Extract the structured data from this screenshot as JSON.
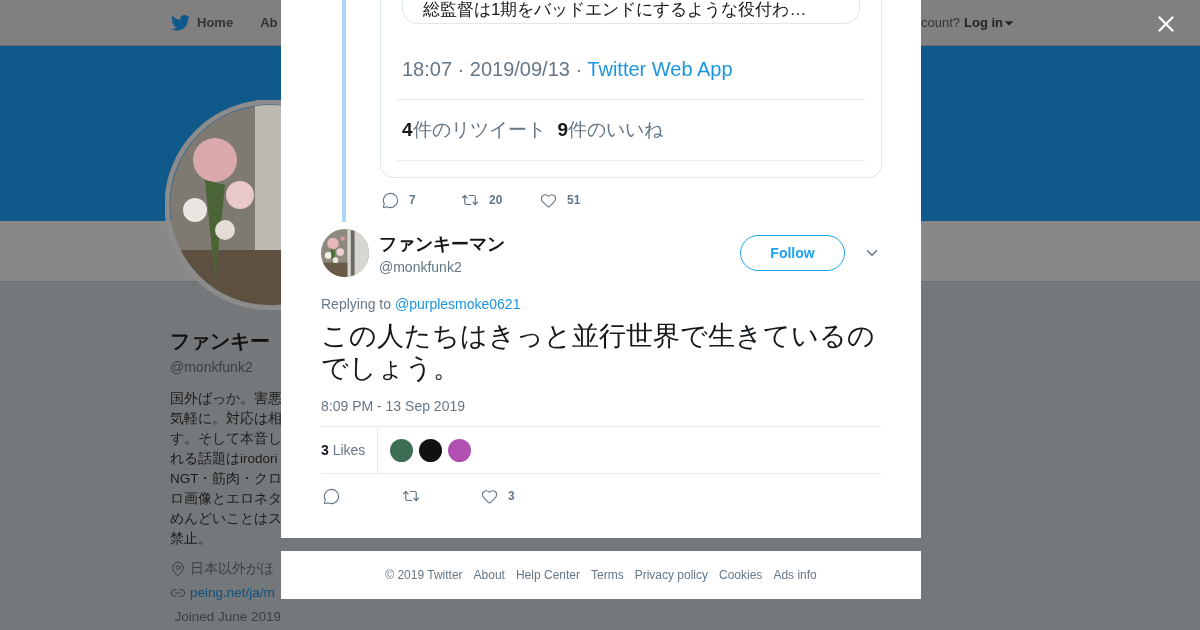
{
  "nav": {
    "items": [
      "Home",
      "Ab"
    ],
    "login_prompt": "count?",
    "login": "Log in"
  },
  "profile": {
    "name": "ファンキー",
    "handle": "@monkfunk2",
    "bio_lines": [
      "国外ばっか。害悪",
      "気軽に。対応は相",
      "す。そして本音し",
      "れる話題はirodori",
      "NGT・筋肉・クロ",
      "ロ画像とエロネタ",
      "めんどいことはス",
      "禁止。"
    ],
    "location": "日本以外がほ",
    "link": "peing.net/ja/m",
    "joined": "Joined June 2019"
  },
  "quoted": {
    "text": "総監督は1期をバッドエンドにするような役付わ…",
    "meta": "18:07 · 2019/09/13 · ",
    "source": "Twitter Web App",
    "retweet_count": "4",
    "retweet_label": "件のリツイート",
    "like_count": "9",
    "like_label": "件のいいね",
    "actions": [
      {
        "kind": "reply",
        "count": "7"
      },
      {
        "kind": "retweet",
        "count": "20"
      },
      {
        "kind": "like",
        "count": "51"
      }
    ]
  },
  "tweet": {
    "name": "ファンキーマン",
    "handle": "@monkfunk2",
    "follow": "Follow",
    "replying_label": "Replying to",
    "replying_to": "@purplesmoke0621",
    "text": "この人たちはきっと並行世界で生きているのでしょう。",
    "time": "8:09 PM - 13 Sep 2019",
    "likes_count": "3",
    "likes_label": "Likes",
    "likers": [
      {
        "color": "#3b6e52"
      },
      {
        "color": "#111111"
      },
      {
        "color": "#b24fb3"
      }
    ],
    "actions": [
      {
        "kind": "reply"
      },
      {
        "kind": "retweet"
      },
      {
        "kind": "like",
        "count": "3"
      }
    ]
  },
  "footer": {
    "links": [
      "© 2019 Twitter",
      "About",
      "Help Center",
      "Terms",
      "Privacy policy",
      "Cookies",
      "Ads info"
    ]
  }
}
